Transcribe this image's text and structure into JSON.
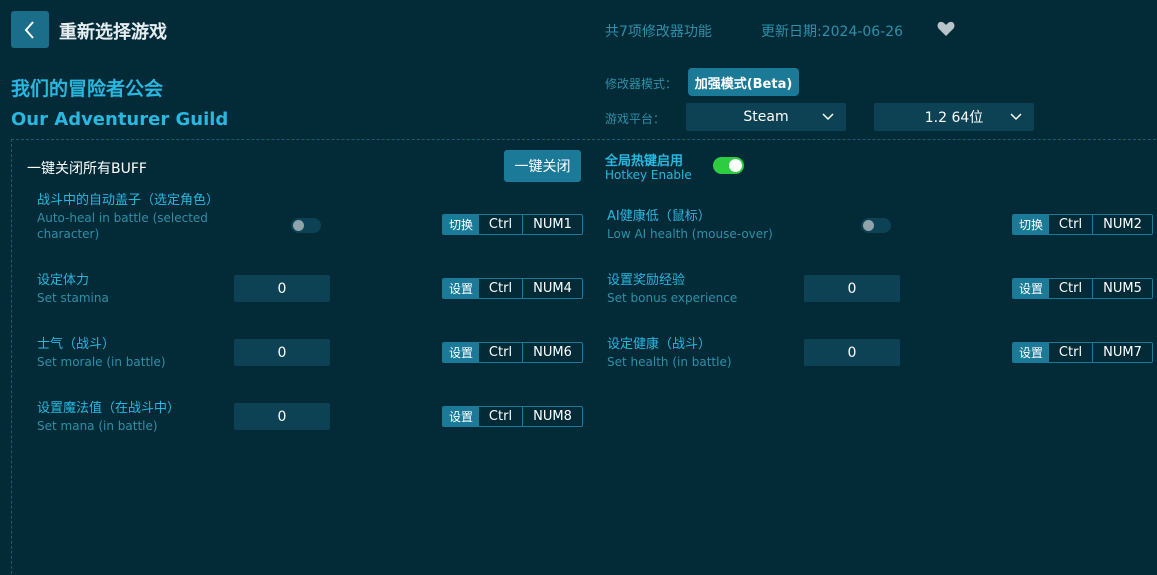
{
  "header": {
    "title": "重新选择游戏",
    "feature_count": "共7项修改器功能",
    "update_date": "更新日期:2024-06-26"
  },
  "game": {
    "name_cn": "我们的冒险者公会",
    "name_en": "Our Adventurer Guild"
  },
  "settings": {
    "mode_label": "修改器模式：",
    "mode_value": "加强模式(Beta)",
    "platform_label": "游戏平台：",
    "platform_value": "Steam",
    "version_value": "1.2 64位"
  },
  "panel": {
    "title": "一键关闭所有BUFF",
    "all_off_label": "一键关闭",
    "hotkey_enable_cn": "全局热键启用",
    "hotkey_enable_en": "Hotkey Enable",
    "hotkey_enabled": true
  },
  "options": [
    {
      "cn": "战斗中的自动盖子（选定角色）",
      "en": "Auto-heal in battle (selected character)",
      "type": "toggle",
      "enabled": false,
      "action": "切换",
      "k1": "Ctrl",
      "k2": "NUM1"
    },
    {
      "cn": "AI健康低（鼠标）",
      "en": "Low AI health (mouse-over)",
      "type": "toggle",
      "enabled": false,
      "action": "切换",
      "k1": "Ctrl",
      "k2": "NUM2"
    },
    {
      "cn": "设定体力",
      "en": "Set stamina",
      "type": "input",
      "value": "0",
      "action": "设置",
      "k1": "Ctrl",
      "k2": "NUM4"
    },
    {
      "cn": "设置奖励经验",
      "en": "Set bonus experience",
      "type": "input",
      "value": "0",
      "action": "设置",
      "k1": "Ctrl",
      "k2": "NUM5"
    },
    {
      "cn": "士气（战斗）",
      "en": "Set morale (in battle)",
      "type": "input",
      "value": "0",
      "action": "设置",
      "k1": "Ctrl",
      "k2": "NUM6"
    },
    {
      "cn": "设定健康（战斗）",
      "en": "Set health (in battle)",
      "type": "input",
      "value": "0",
      "action": "设置",
      "k1": "Ctrl",
      "k2": "NUM7"
    },
    {
      "cn": "设置魔法值（在战斗中）",
      "en": "Set mana (in battle)",
      "type": "input",
      "value": "0",
      "action": "设置",
      "k1": "Ctrl",
      "k2": "NUM8"
    }
  ],
  "icons": {
    "back": "chevron-left-icon",
    "favorite": "heart-icon",
    "dropdown": "chevron-down-icon"
  },
  "colors": {
    "background": "#022a37",
    "accent": "#29b7e0",
    "button": "#1a7a98",
    "toggle_on": "#2ecc40"
  }
}
